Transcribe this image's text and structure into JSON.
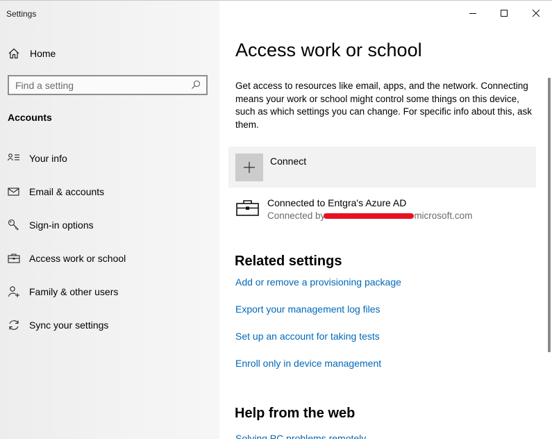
{
  "window": {
    "app_title": "Settings",
    "controls": {
      "minimize_icon": "minimize-icon",
      "maximize_icon": "maximize-icon",
      "close_icon": "close-icon"
    }
  },
  "sidebar": {
    "home": {
      "label": "Home",
      "icon": "home-icon"
    },
    "search": {
      "placeholder": "Find a setting",
      "value": "",
      "icon": "search-icon"
    },
    "section": "Accounts",
    "items": [
      {
        "label": "Your info",
        "icon": "person-card-icon"
      },
      {
        "label": "Email & accounts",
        "icon": "mail-icon"
      },
      {
        "label": "Sign-in options",
        "icon": "key-icon"
      },
      {
        "label": "Access work or school",
        "icon": "briefcase-icon"
      },
      {
        "label": "Family & other users",
        "icon": "person-add-icon"
      },
      {
        "label": "Sync your settings",
        "icon": "sync-icon"
      }
    ]
  },
  "main": {
    "title": "Access work or school",
    "description": "Get access to resources like email, apps, and the network. Connecting means your work or school might control some things on this device, such as which settings you can change. For specific info about this, ask them.",
    "connect": {
      "label": "Connect",
      "icon": "plus-icon"
    },
    "account": {
      "title": "Connected to Entgra's Azure AD",
      "subtitle_prefix": "Connected by",
      "subtitle_suffix": "microsoft.com",
      "icon": "briefcase-icon"
    },
    "related": {
      "heading": "Related settings",
      "links": [
        "Add or remove a provisioning package",
        "Export your management log files",
        "Set up an account for taking tests",
        "Enroll only in device management"
      ]
    },
    "help": {
      "heading": "Help from the web",
      "links": [
        "Solving PC problems remotely"
      ]
    }
  },
  "colors": {
    "link": "#0067b8",
    "redaction": "#e81123",
    "sidebar_bg": "#f2f2f2",
    "tile_bg": "#f2f2f2"
  }
}
